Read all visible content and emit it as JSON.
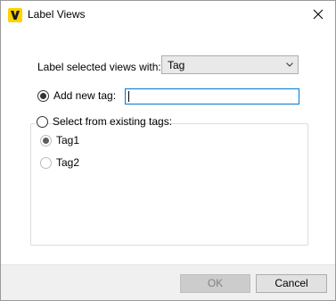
{
  "window": {
    "title": "Label Views"
  },
  "label_row": {
    "label": "Label selected views with:",
    "combo_value": "Tag"
  },
  "add_new": {
    "label": "Add new tag:",
    "input_value": "",
    "selected": true
  },
  "existing": {
    "label": "Select from existing tags:",
    "selected": false,
    "tags": [
      {
        "label": "Tag1",
        "selected": true
      },
      {
        "label": "Tag2",
        "selected": false
      }
    ]
  },
  "footer": {
    "ok_label": "OK",
    "ok_enabled": false,
    "cancel_label": "Cancel"
  },
  "colors": {
    "brand": "#ffd200",
    "focus": "#0078d7"
  },
  "icons": {
    "app": "v-logo-icon",
    "close": "close-icon",
    "combo": "chevron-down-icon"
  }
}
